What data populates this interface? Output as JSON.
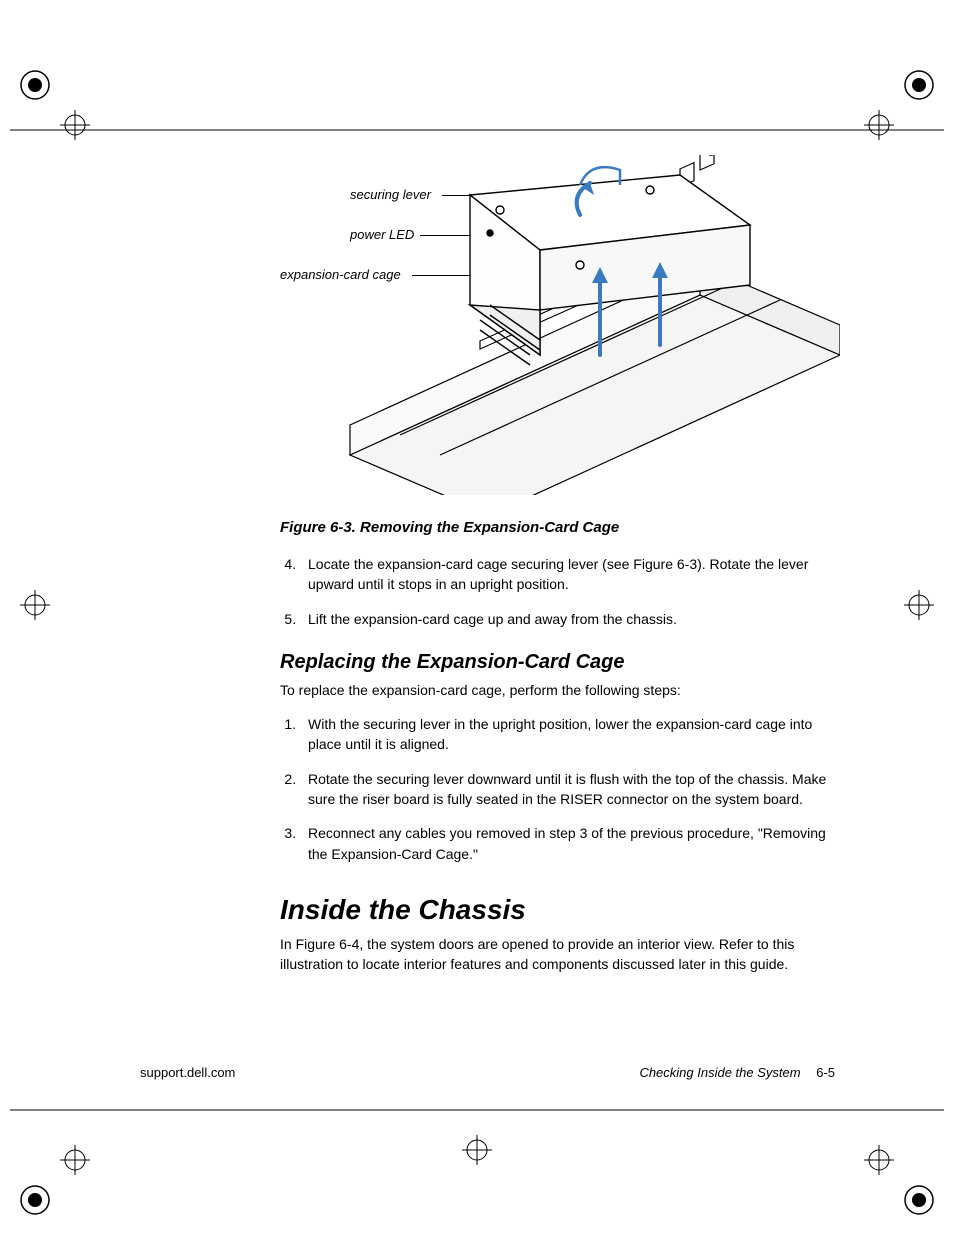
{
  "figure": {
    "labels": {
      "securing_lever": "securing lever",
      "power_led": "power LED",
      "expansion_card_cage": "expansion-card cage"
    },
    "caption": "Figure 6-3.  Removing the Expansion-Card Cage"
  },
  "list_remove": {
    "start": 4,
    "items": [
      "Locate the expansion-card cage securing lever (see Figure 6-3). Rotate the lever upward until it stops in an upright position.",
      "Lift the expansion-card cage up and away from the chassis."
    ]
  },
  "section_replace": {
    "heading": "Replacing the Expansion-Card Cage",
    "intro": "To replace the expansion-card cage, perform the following steps:",
    "items": [
      "With the securing lever in the upright position, lower the expansion-card cage into place until it is aligned.",
      "Rotate the securing lever downward until it is flush with the top of the chassis. Make sure the riser board is fully seated in the RISER connector on the system board.",
      "Reconnect any cables you removed in step 3 of the previous procedure, \"Removing the Expansion-Card Cage.\""
    ]
  },
  "section_inside": {
    "heading": "Inside the Chassis",
    "body": "In Figure 6-4, the system doors are opened to provide an interior view. Refer to this illustration to locate interior features and components discussed later in this guide."
  },
  "footer": {
    "left": "support.dell.com",
    "right_title": "Checking Inside the System",
    "page_num": "6-5"
  }
}
